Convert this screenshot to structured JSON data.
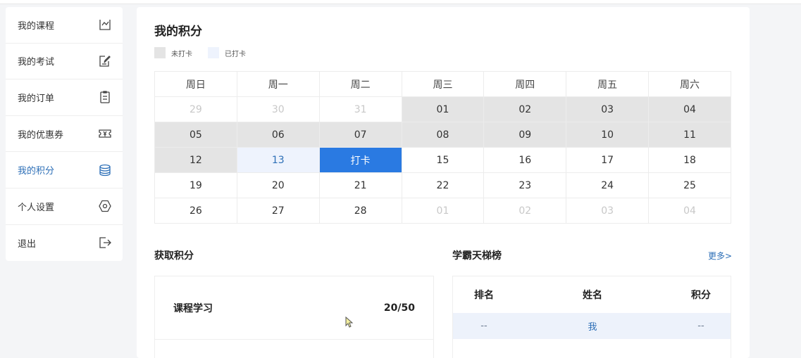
{
  "sidebar": {
    "items": [
      {
        "label": "我的课程",
        "icon": "chart-line-icon",
        "active": false
      },
      {
        "label": "我的考试",
        "icon": "edit-icon",
        "active": false
      },
      {
        "label": "我的订单",
        "icon": "clipboard-icon",
        "active": false
      },
      {
        "label": "我的优惠券",
        "icon": "coupon-icon",
        "active": false
      },
      {
        "label": "我的积分",
        "icon": "coins-icon",
        "active": true
      },
      {
        "label": "个人设置",
        "icon": "settings-hexagon-icon",
        "active": false
      },
      {
        "label": "退出",
        "icon": "logout-icon",
        "active": false
      }
    ]
  },
  "main": {
    "title": "我的积分",
    "legend": {
      "unchecked": "未打卡",
      "checked": "已打卡"
    },
    "calendar": {
      "weekdays": [
        "周日",
        "周一",
        "周二",
        "周三",
        "周四",
        "周五",
        "周六"
      ],
      "weeks": [
        [
          {
            "d": "29",
            "t": "other"
          },
          {
            "d": "30",
            "t": "other"
          },
          {
            "d": "31",
            "t": "other"
          },
          {
            "d": "01",
            "t": "past"
          },
          {
            "d": "02",
            "t": "past"
          },
          {
            "d": "03",
            "t": "past"
          },
          {
            "d": "04",
            "t": "past"
          }
        ],
        [
          {
            "d": "05",
            "t": "past"
          },
          {
            "d": "06",
            "t": "past"
          },
          {
            "d": "07",
            "t": "past"
          },
          {
            "d": "08",
            "t": "past"
          },
          {
            "d": "09",
            "t": "past"
          },
          {
            "d": "10",
            "t": "past"
          },
          {
            "d": "11",
            "t": "past"
          }
        ],
        [
          {
            "d": "12",
            "t": "past"
          },
          {
            "d": "13",
            "t": "checked"
          },
          {
            "d": "打卡",
            "t": "checkin"
          },
          {
            "d": "15",
            "t": "normal"
          },
          {
            "d": "16",
            "t": "normal"
          },
          {
            "d": "17",
            "t": "normal"
          },
          {
            "d": "18",
            "t": "normal"
          }
        ],
        [
          {
            "d": "19",
            "t": "normal"
          },
          {
            "d": "20",
            "t": "normal"
          },
          {
            "d": "21",
            "t": "normal"
          },
          {
            "d": "22",
            "t": "normal"
          },
          {
            "d": "23",
            "t": "normal"
          },
          {
            "d": "24",
            "t": "normal"
          },
          {
            "d": "25",
            "t": "normal"
          }
        ],
        [
          {
            "d": "26",
            "t": "normal"
          },
          {
            "d": "27",
            "t": "normal"
          },
          {
            "d": "28",
            "t": "normal"
          },
          {
            "d": "01",
            "t": "other"
          },
          {
            "d": "02",
            "t": "other"
          },
          {
            "d": "03",
            "t": "other"
          },
          {
            "d": "04",
            "t": "other"
          }
        ]
      ]
    },
    "earn": {
      "title": "获取积分",
      "rows": [
        {
          "label": "课程学习",
          "value": "20/50"
        }
      ]
    },
    "ranking": {
      "title": "学霸天梯榜",
      "more": "更多>",
      "headers": [
        "排名",
        "姓名",
        "积分"
      ],
      "rows": [
        {
          "rank": "--",
          "name": "我",
          "score": "--"
        }
      ]
    }
  },
  "colors": {
    "accent": "#2a7ae2",
    "link": "#2d6fb7",
    "past_cell": "#e4e4e4",
    "checked_cell": "#eef3fd"
  }
}
